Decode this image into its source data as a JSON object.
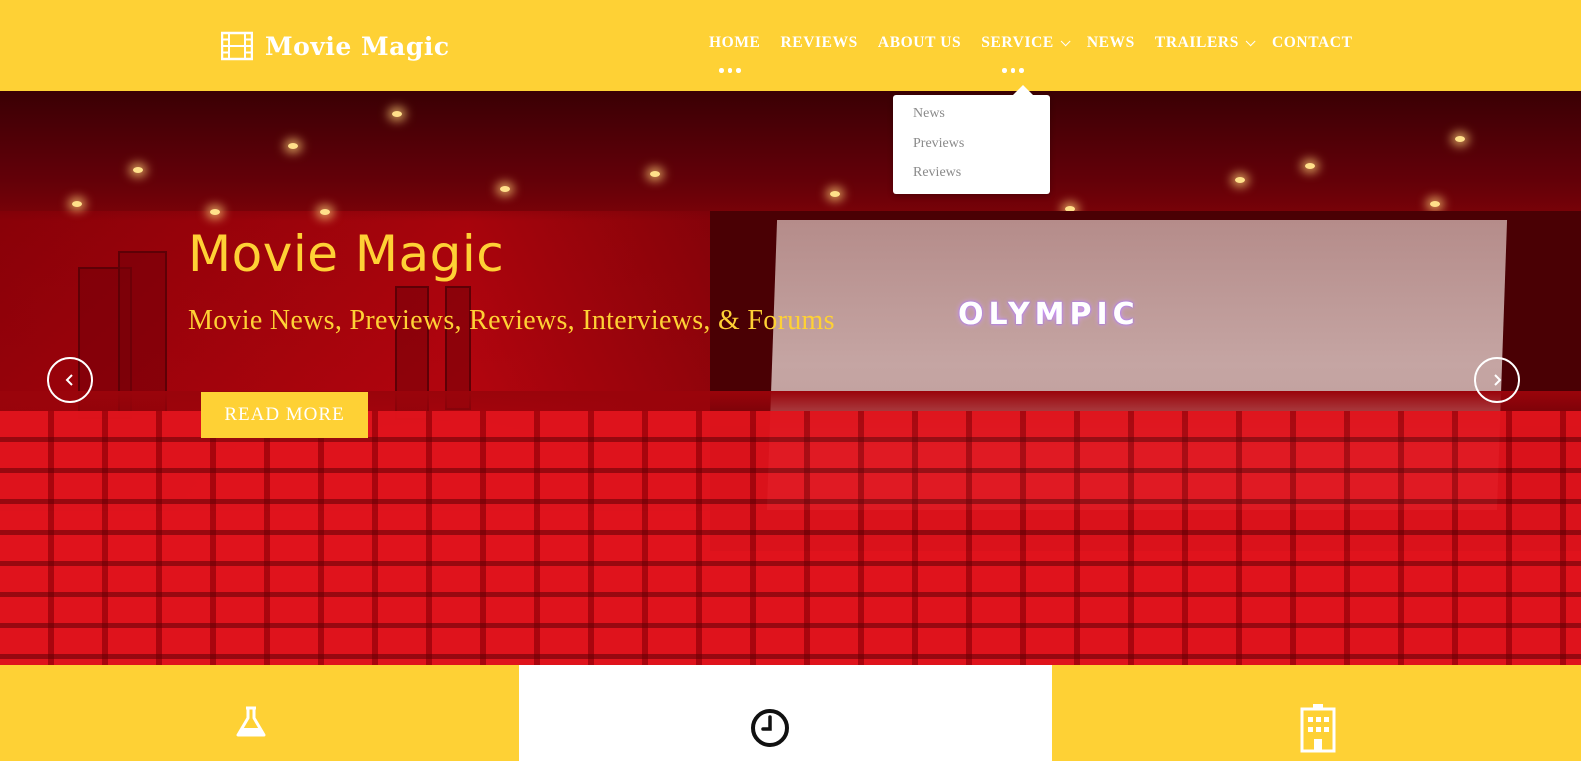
{
  "brand": {
    "name": "Movie Magic",
    "logo_icon": "film-icon",
    "color": "#fed135"
  },
  "nav": {
    "items": [
      {
        "label": "HOME",
        "active": true
      },
      {
        "label": "REVIEWS"
      },
      {
        "label": "ABOUT US"
      },
      {
        "label": "SERVICE",
        "has_dropdown": true,
        "open": true
      },
      {
        "label": "NEWS"
      },
      {
        "label": "TRAILERS",
        "has_dropdown": true
      },
      {
        "label": "CONTACT"
      }
    ]
  },
  "dropdown": {
    "items": [
      "News",
      "Previews",
      "Reviews"
    ]
  },
  "hero": {
    "title": "Movie Magic",
    "subtitle": "Movie News, Previews, Reviews, Interviews, & Forums",
    "button_label": "READ MORE",
    "screen_text": "OLYMPIC",
    "prev_icon": "chevron-left-icon",
    "next_icon": "chevron-right-icon"
  },
  "features": [
    {
      "icon": "flask-icon"
    },
    {
      "icon": "clock-icon"
    },
    {
      "icon": "building-icon"
    }
  ]
}
